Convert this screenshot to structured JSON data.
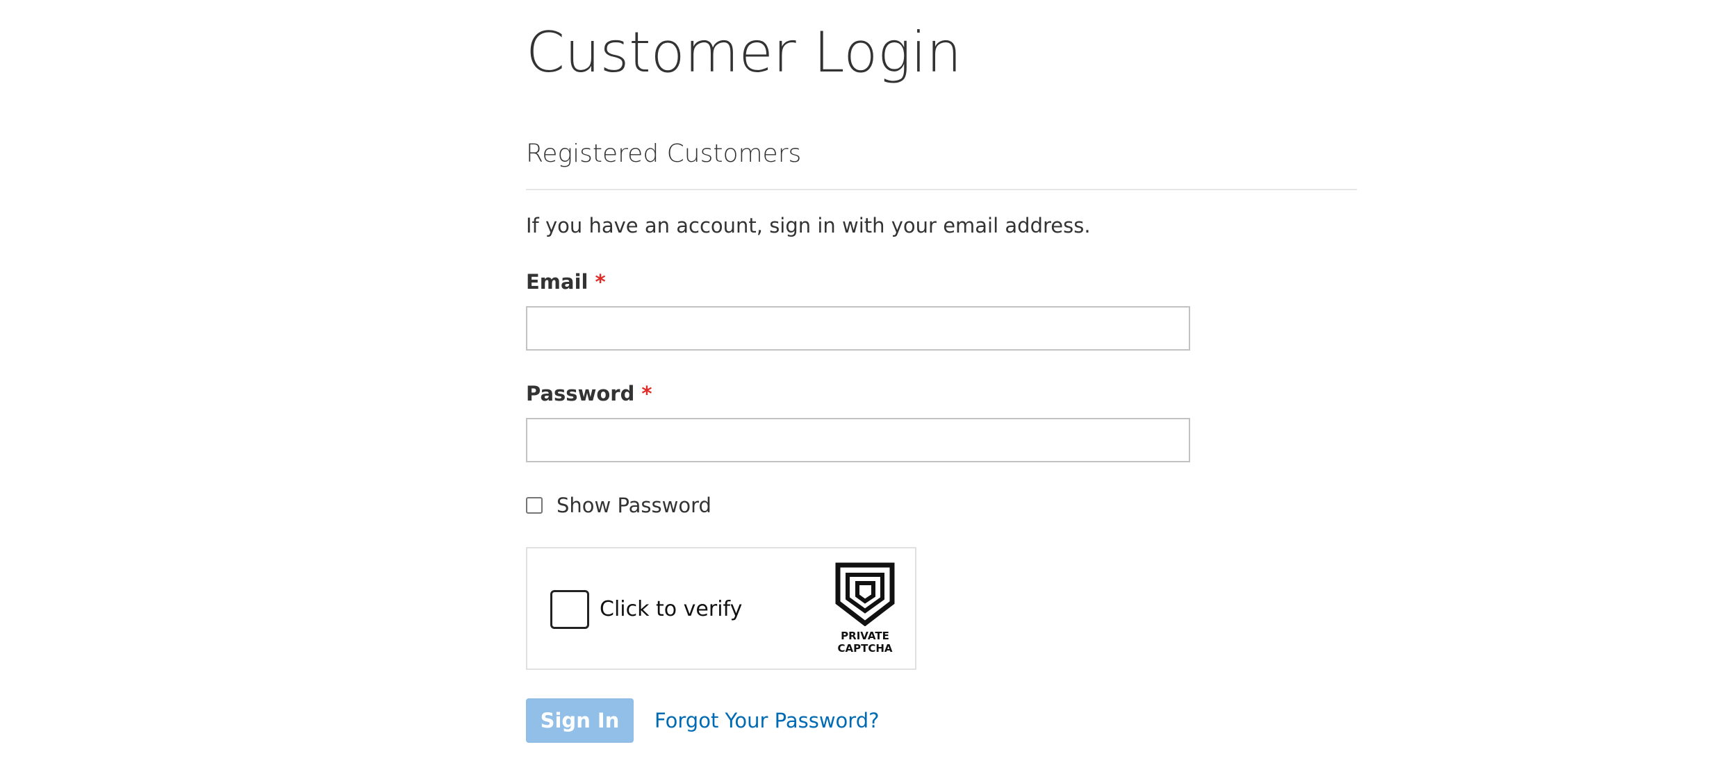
{
  "page": {
    "title": "Customer Login"
  },
  "login_block": {
    "title": "Registered Customers",
    "intro": "If you have an account, sign in with your email address."
  },
  "form": {
    "email": {
      "label": "Email",
      "required_mark": "*",
      "value": "",
      "placeholder": ""
    },
    "password": {
      "label": "Password",
      "required_mark": "*",
      "value": "",
      "placeholder": ""
    },
    "show_password": {
      "label": "Show Password",
      "checked": false
    }
  },
  "captcha": {
    "verify_label": "Click to verify",
    "brand_line1": "PRIVATE",
    "brand_line2": "CAPTCHA",
    "logo_icon": "shield-logo-icon"
  },
  "actions": {
    "sign_in_label": "Sign In",
    "forgot_label": "Forgot Your Password?"
  },
  "colors": {
    "required": "#e02b27",
    "link": "#006bb4",
    "primary_button_disabled": "#92bfe7",
    "text": "#333333"
  }
}
